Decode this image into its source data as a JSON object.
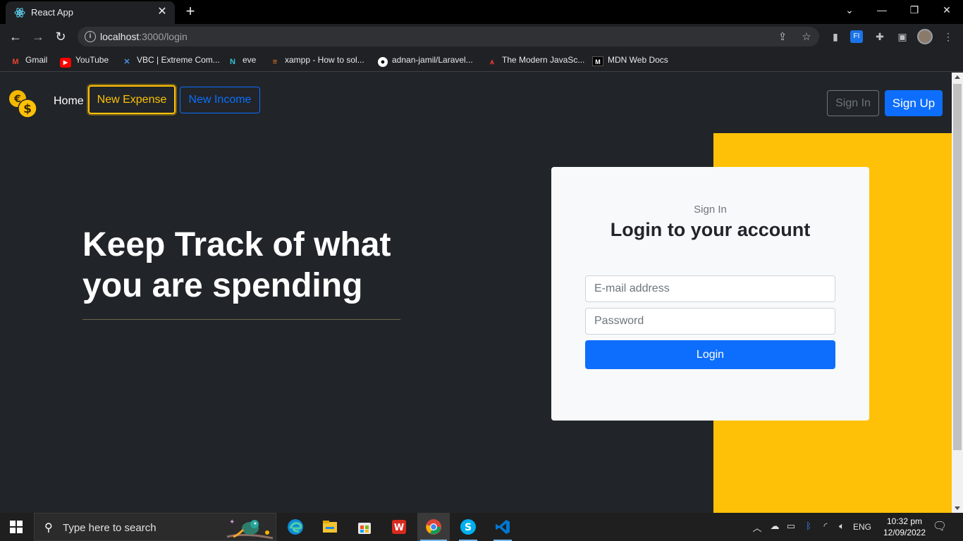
{
  "browser": {
    "tab_title": "React App",
    "url_host": "localhost",
    "url_rest": ":3000/login",
    "bookmarks": [
      {
        "label": "Gmail",
        "icon": "gmail-icon"
      },
      {
        "label": "YouTube",
        "icon": "youtube-icon"
      },
      {
        "label": "VBC | Extreme Com...",
        "icon": "vbc-icon"
      },
      {
        "label": "eve",
        "icon": "eve-icon"
      },
      {
        "label": "xampp - How to sol...",
        "icon": "stackoverflow-icon"
      },
      {
        "label": "adnan-jamil/Laravel...",
        "icon": "github-icon"
      },
      {
        "label": "The Modern JavaSc...",
        "icon": "javascript-info-icon"
      },
      {
        "label": "MDN Web Docs",
        "icon": "mdn-icon"
      }
    ]
  },
  "navbar": {
    "home": "Home",
    "new_expense": "New Expense",
    "new_income": "New Income",
    "sign_in": "Sign In",
    "sign_up": "Sign Up"
  },
  "hero": {
    "line1": "Keep Track of what",
    "line2": "you are spending"
  },
  "login": {
    "eyebrow": "Sign In",
    "heading": "Login to your account",
    "email_placeholder": "E-mail address",
    "password_placeholder": "Password",
    "button": "Login"
  },
  "taskbar": {
    "search_placeholder": "Type here to search",
    "language": "ENG",
    "time": "10:32 pm",
    "date": "12/09/2022"
  },
  "colors": {
    "accent_yellow": "#ffc107",
    "primary_blue": "#0d6efd",
    "page_bg": "#212529"
  }
}
